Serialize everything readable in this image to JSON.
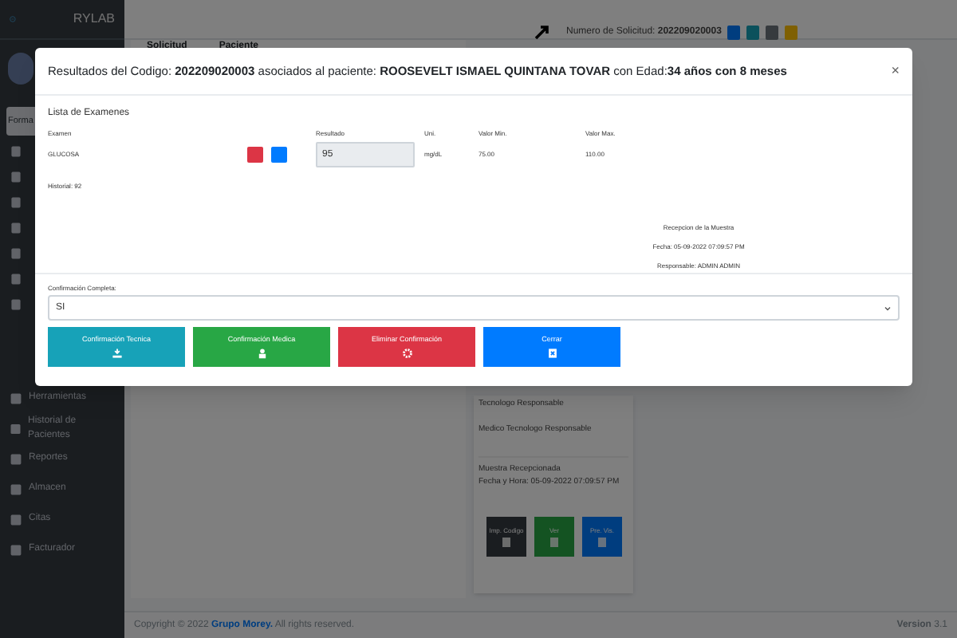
{
  "sidebar": {
    "brand": "RYLAB",
    "format_button": "Forma",
    "items": [
      {
        "label": "Herramientas"
      },
      {
        "label": "Historial de Pacientes"
      },
      {
        "label": "Reportes"
      },
      {
        "label": "Almacen"
      },
      {
        "label": "Citas"
      },
      {
        "label": "Facturador"
      }
    ]
  },
  "table": {
    "columns": [
      "Solicitud",
      "Paciente"
    ]
  },
  "request": {
    "label": "Numero de Solicitud:",
    "number": "202209020003"
  },
  "detail_card": {
    "lines": [
      "Tecnologo Responsable",
      "Medico Tecnologo Responsable"
    ],
    "received": "Muestra Recepcionada",
    "datetime": "Fecha y Hora: 05-09-2022 07:09:57 PM",
    "buttons": [
      {
        "label": "Imp. Codigo",
        "kind": "print"
      },
      {
        "label": "Ver",
        "kind": "view"
      },
      {
        "label": "Pre. Vis.",
        "kind": "preview"
      }
    ]
  },
  "footer": {
    "copyright": "Copyright © 2022 ",
    "company": "Grupo Morey.",
    "rights": " All rights reserved.",
    "version_label": "Version",
    "version": "3.1"
  },
  "modal": {
    "title": "Resultados del Codigo: **202209020003** asociados al paciente: **ROOSEVELT ISMAEL QUINTANA TOVAR** con Edad:**34 años con 8 meses**",
    "close": "×",
    "section": "Lista de Examenes",
    "columns": [
      "Examen",
      "Resultado",
      "Uni.",
      "Valor Min.",
      "Valor Max."
    ],
    "rows": [
      {
        "exam": "GLUCOSA",
        "result": "95",
        "unit": "mg/dL",
        "min": "75.00",
        "max": "110.00"
      }
    ],
    "history": "Historial: 92",
    "reception": [
      "Recepcion de la Muestra",
      "Fecha: 05-09-2022 07:09:57 PM",
      "Responsable: ADMIN ADMIN"
    ],
    "confirm_label": "Confirmación Completa:",
    "confirm_value": "SI",
    "actions": [
      {
        "label": "Confirmación Tecnica",
        "kind": "tech"
      },
      {
        "label": "Confirmación Medica",
        "kind": "medic"
      },
      {
        "label": "Eliminar Confirmación",
        "kind": "delete"
      },
      {
        "label": "Cerrar",
        "kind": "close"
      }
    ]
  }
}
